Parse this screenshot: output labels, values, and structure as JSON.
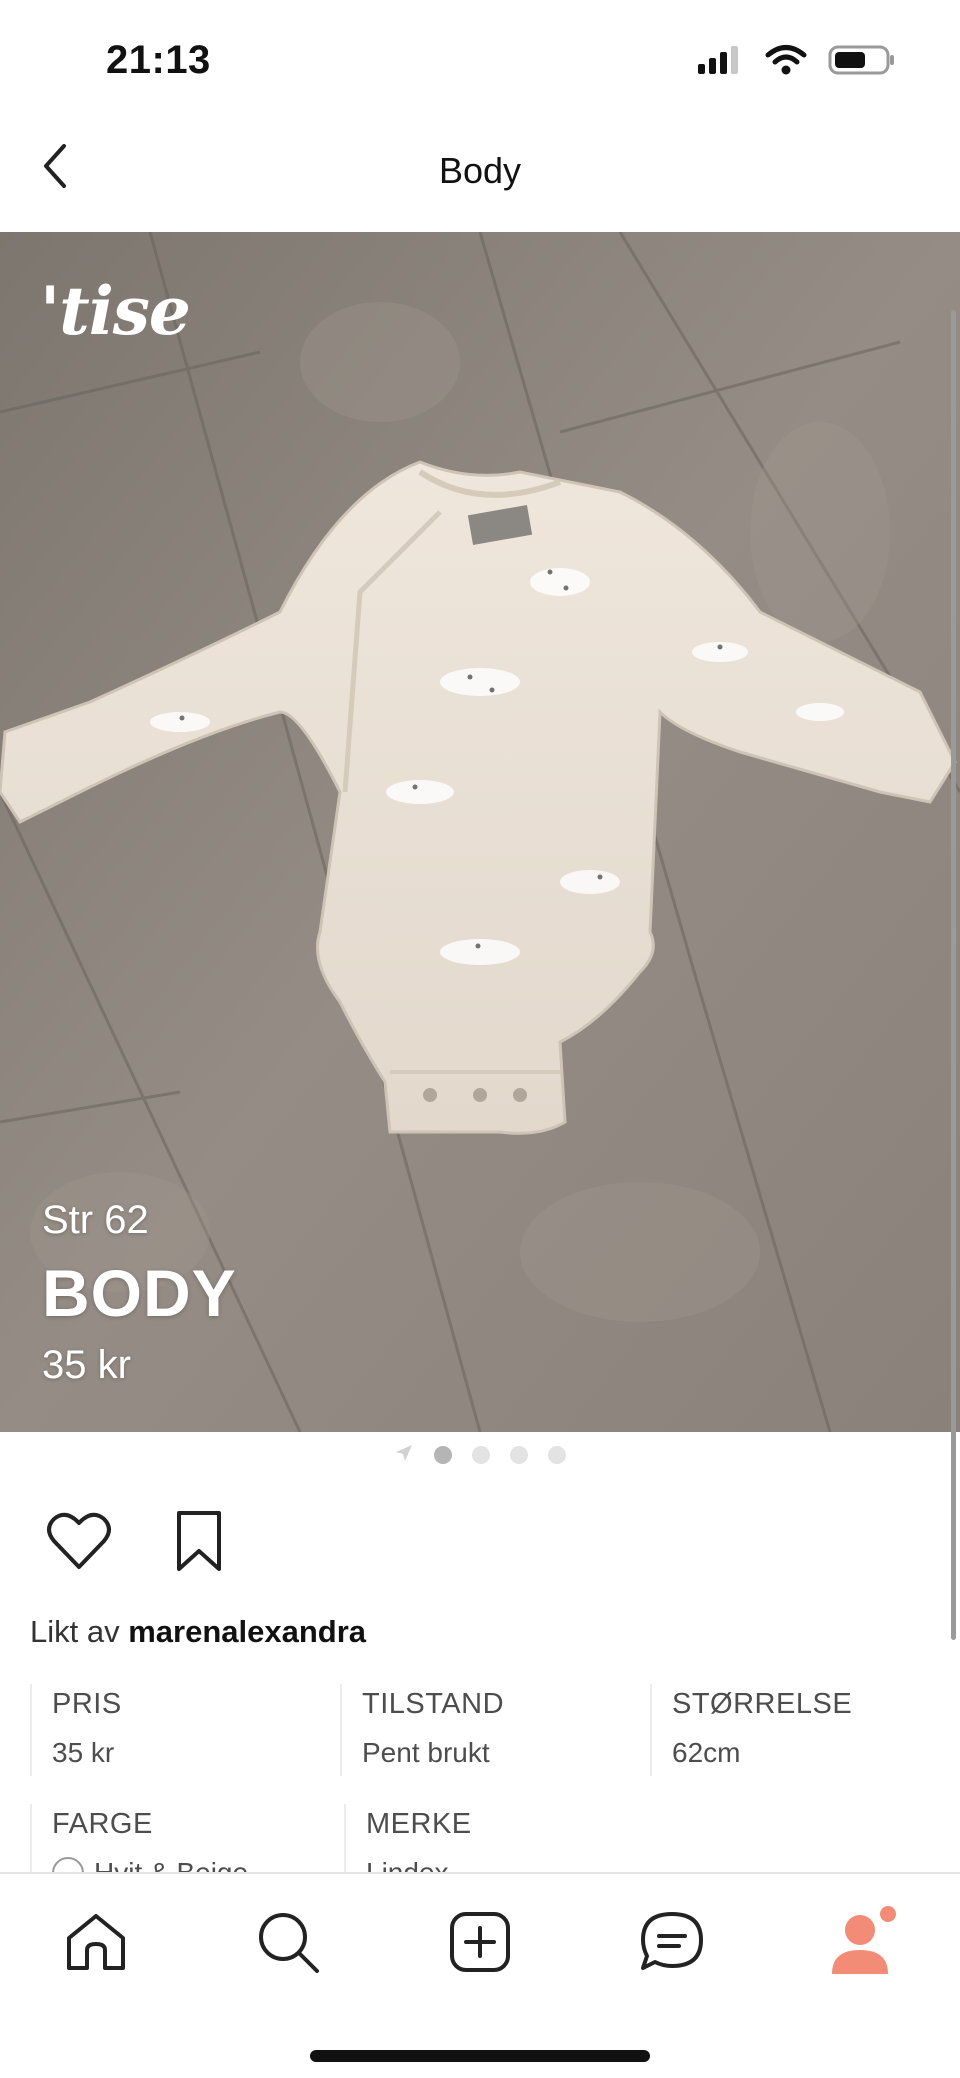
{
  "status_bar": {
    "time": "21:13",
    "icons": [
      "cellular-signal-icon",
      "wifi-icon",
      "battery-icon"
    ]
  },
  "nav": {
    "title": "Body",
    "back_icon": "chevron-left-icon"
  },
  "listing": {
    "brand_logo": "'tise",
    "photo_subject": "Beige long-sleeve baby body with print on a wooden floor",
    "caption_size": "Str 62",
    "caption_title": "BODY",
    "caption_price": "35 kr",
    "pager": {
      "total": 4,
      "active": 1,
      "first_icon": "location-arrow-icon"
    }
  },
  "actions": {
    "like_icon": "heart-icon",
    "save_icon": "bookmark-icon"
  },
  "liked_by": {
    "prefix": "Likt av",
    "user": "marenalexandra"
  },
  "attributes": [
    {
      "label": "PRIS",
      "value": "35 kr"
    },
    {
      "label": "TILSTAND",
      "value": "Pent brukt"
    },
    {
      "label": "STØRRELSE",
      "value": "62cm"
    },
    {
      "label": "FARGE",
      "value": "Hvit & Beige",
      "swatch": "#ffffff"
    },
    {
      "label": "MERKE",
      "value": "Lindex"
    }
  ],
  "tabbar": {
    "tabs": [
      "home-icon",
      "search-icon",
      "add-listing-icon",
      "messages-icon",
      "profile-icon"
    ],
    "accent_color": "#f28c76",
    "notification_dot": true
  }
}
